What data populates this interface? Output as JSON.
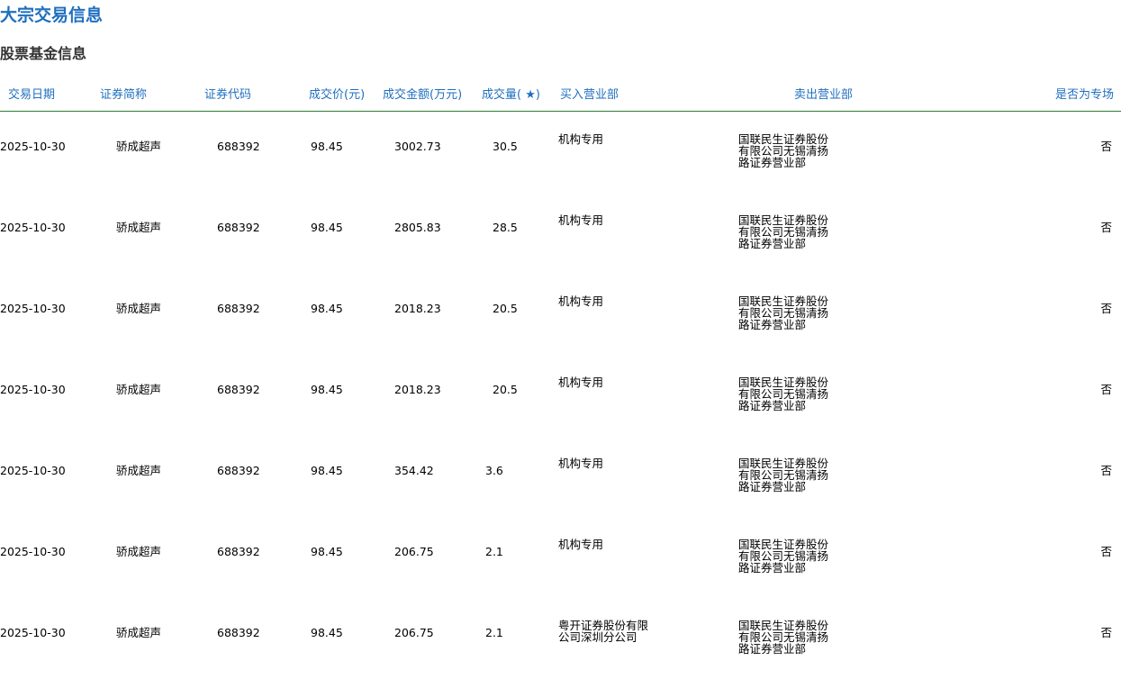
{
  "page_title": "大宗交易信息",
  "section_title": "股票基金信息",
  "headers": {
    "date": "交易日期",
    "name": "证券简称",
    "code": "证券代码",
    "price": "成交价(元)",
    "amount": "成交金额(万元)",
    "volume": "成交量( ★)",
    "buy_branch": "买入营业部",
    "sell_branch": "卖出营业部",
    "special": "是否为专场"
  },
  "rows": [
    {
      "date": "2025-10-30",
      "name": "骄成超声",
      "code": "688392",
      "price": "98.45",
      "amount": "3002.73",
      "volume": "30.5",
      "buy_branch": "机构专用",
      "sell_branch": "国联民生证券股份有限公司无锡清扬路证券营业部",
      "special": "否"
    },
    {
      "date": "2025-10-30",
      "name": "骄成超声",
      "code": "688392",
      "price": "98.45",
      "amount": "2805.83",
      "volume": "28.5",
      "buy_branch": "机构专用",
      "sell_branch": "国联民生证券股份有限公司无锡清扬路证券营业部",
      "special": "否"
    },
    {
      "date": "2025-10-30",
      "name": "骄成超声",
      "code": "688392",
      "price": "98.45",
      "amount": "2018.23",
      "volume": "20.5",
      "buy_branch": "机构专用",
      "sell_branch": "国联民生证券股份有限公司无锡清扬路证券营业部",
      "special": "否"
    },
    {
      "date": "2025-10-30",
      "name": "骄成超声",
      "code": "688392",
      "price": "98.45",
      "amount": "2018.23",
      "volume": "20.5",
      "buy_branch": "机构专用",
      "sell_branch": "国联民生证券股份有限公司无锡清扬路证券营业部",
      "special": "否"
    },
    {
      "date": "2025-10-30",
      "name": "骄成超声",
      "code": "688392",
      "price": "98.45",
      "amount": "354.42",
      "volume": "3.6",
      "buy_branch": "机构专用",
      "sell_branch": "国联民生证券股份有限公司无锡清扬路证券营业部",
      "special": "否"
    },
    {
      "date": "2025-10-30",
      "name": "骄成超声",
      "code": "688392",
      "price": "98.45",
      "amount": "206.75",
      "volume": "2.1",
      "buy_branch": "机构专用",
      "sell_branch": "国联民生证券股份有限公司无锡清扬路证券营业部",
      "special": "否"
    },
    {
      "date": "2025-10-30",
      "name": "骄成超声",
      "code": "688392",
      "price": "98.45",
      "amount": "206.75",
      "volume": "2.1",
      "buy_branch": "粤开证券股份有限公司深圳分公司",
      "sell_branch": "国联民生证券股份有限公司无锡清扬路证券营业部",
      "special": "否"
    }
  ]
}
